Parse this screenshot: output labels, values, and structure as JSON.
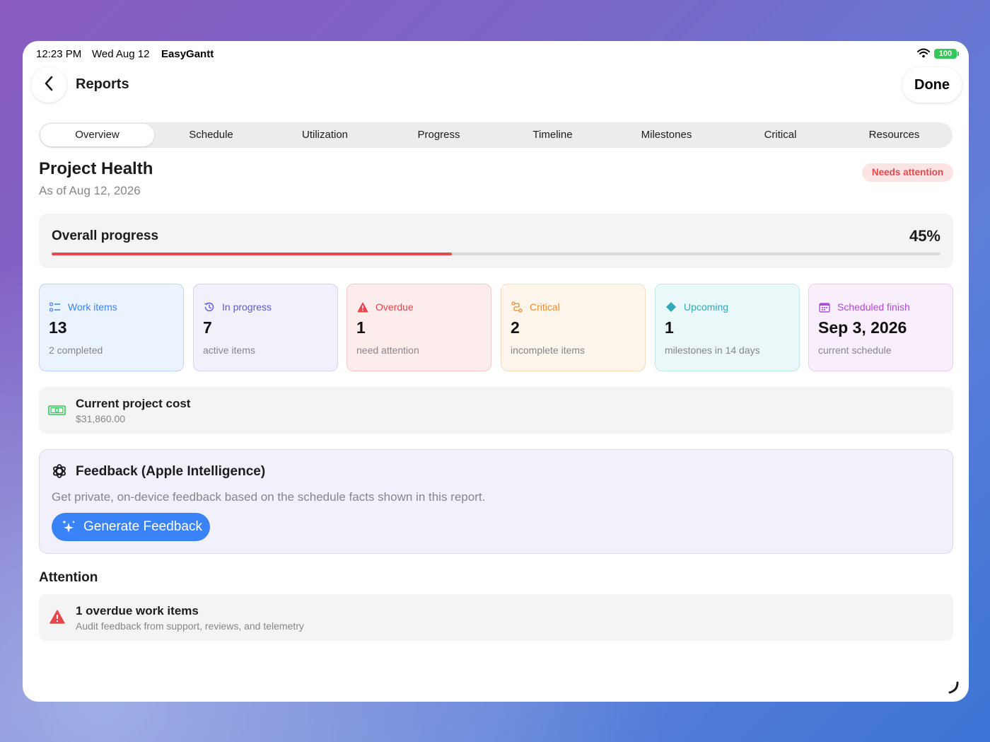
{
  "status_bar": {
    "time": "12:23 PM",
    "date": "Wed Aug 12",
    "app": "EasyGantt",
    "battery": "100"
  },
  "nav": {
    "back_icon": "chevron-left-icon",
    "title": "Reports",
    "done_label": "Done"
  },
  "tabs": [
    {
      "label": "Overview",
      "active": true
    },
    {
      "label": "Schedule",
      "active": false
    },
    {
      "label": "Utilization",
      "active": false
    },
    {
      "label": "Progress",
      "active": false
    },
    {
      "label": "Timeline",
      "active": false
    },
    {
      "label": "Milestones",
      "active": false
    },
    {
      "label": "Critical",
      "active": false
    },
    {
      "label": "Resources",
      "active": false
    }
  ],
  "health": {
    "title": "Project Health",
    "date": "As of Aug 12, 2026",
    "badge": "Needs attention",
    "badge_color": "#e5484d"
  },
  "progress": {
    "label": "Overall progress",
    "percent_text": "45%",
    "fraction": 0.45,
    "color": "#e5484d"
  },
  "stats": [
    {
      "label": "Work items",
      "value": "13",
      "sub": "2 completed",
      "icon": "list-icon",
      "color": "#3a82f7",
      "bg": "#ebf3fe",
      "border": "#bfd6f7"
    },
    {
      "label": "In progress",
      "value": "7",
      "sub": "active items",
      "icon": "history-clock-icon",
      "color": "#5b5bd6",
      "bg": "#f1f0fb",
      "border": "#d6d4f2"
    },
    {
      "label": "Overdue",
      "value": "1",
      "sub": "need attention",
      "icon": "warning-triangle-icon",
      "color": "#e5484d",
      "bg": "#fcecec",
      "border": "#f3caca"
    },
    {
      "label": "Critical",
      "value": "2",
      "sub": "incomplete items",
      "icon": "path-icon",
      "color": "#f08c2e",
      "bg": "#fef5ec",
      "border": "#f7dcc0"
    },
    {
      "label": "Upcoming",
      "value": "1",
      "sub": "milestones in 14 days",
      "icon": "diamond-icon",
      "color": "#2fa8b8",
      "bg": "#ebf8fa",
      "border": "#c2e6ec"
    },
    {
      "label": "Scheduled finish",
      "value": "Sep 3, 2026",
      "sub": "current schedule",
      "icon": "calendar-icon",
      "color": "#b04ad4",
      "bg": "#f9eefc",
      "border": "#e7cdf2"
    }
  ],
  "cost": {
    "title": "Current project cost",
    "value": "$31,860.00",
    "icon": "banknote-icon",
    "icon_color": "#34c759"
  },
  "feedback": {
    "title": "Feedback (Apple Intelligence)",
    "description": "Get private, on-device feedback based on the schedule facts shown in this report.",
    "button_label": "Generate Feedback",
    "icon": "apple-intelligence-icon",
    "button_icon": "sparkles-icon",
    "accent": "#3a82f7"
  },
  "attention": {
    "title": "Attention",
    "items": [
      {
        "title": "1 overdue work items",
        "subtitle": "Audit feedback from support, reviews, and telemetry",
        "icon": "warning-triangle-icon"
      }
    ]
  }
}
